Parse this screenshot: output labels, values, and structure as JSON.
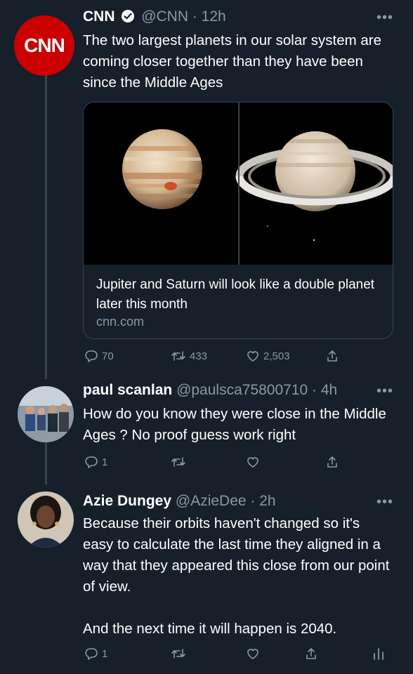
{
  "colors": {
    "background": "#15202b",
    "text": "#ffffff",
    "secondary": "#8899a6",
    "border": "#38444d",
    "cnn_red": "#cc0000"
  },
  "tweets": [
    {
      "author": "CNN",
      "verified": true,
      "handle_time": "@CNN · 12h",
      "text": "The two largest planets in our solar system are coming closer together than they have been since the Middle Ages",
      "avatar_text": "CNN",
      "card": {
        "title": "Jupiter and Saturn will look like a double planet later this month",
        "domain": "cnn.com"
      },
      "actions": {
        "reply": "70",
        "retweet": "433",
        "like": "2,503"
      }
    },
    {
      "author": "paul scanlan",
      "handle_time": "@paulsca75800710 · 4h",
      "text": "How do you know they were close in the Middle Ages ? No proof guess work right",
      "actions": {
        "reply": "1"
      }
    },
    {
      "author": "Azie Dungey",
      "handle_time": "@AzieDee · 2h",
      "text": "Because their orbits haven't changed so it's easy to calculate the last time they aligned in a way that they appeared this close from our point of view.\n\nAnd the next time it will happen is 2040.",
      "actions": {
        "reply": "1"
      }
    }
  ],
  "icons": [
    "verified-badge-icon",
    "more-icon",
    "reply-icon",
    "retweet-icon",
    "like-icon",
    "share-icon",
    "analytics-icon"
  ]
}
